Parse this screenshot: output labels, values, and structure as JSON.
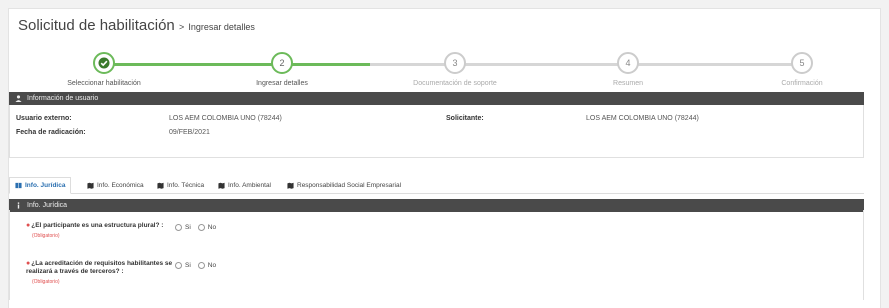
{
  "header": {
    "title": "Solicitud de habilitación",
    "breadcrumb_sep": ">",
    "breadcrumb": "Ingresar detalles"
  },
  "stepper": {
    "steps": [
      {
        "number": "✔",
        "label": "Seleccionar habilitación",
        "state": "done"
      },
      {
        "number": "2",
        "label": "Ingresar detalles",
        "state": "active"
      },
      {
        "number": "3",
        "label": "Documentación de soporte",
        "state": "pending"
      },
      {
        "number": "4",
        "label": "Resumen",
        "state": "pending"
      },
      {
        "number": "5",
        "label": "Confirmación",
        "state": "pending"
      }
    ],
    "colors": {
      "done": "#6cba5a",
      "pending": "#cccccc"
    }
  },
  "user_info": {
    "section_title": "Información de usuario",
    "section_icon": "user-icon",
    "external_user_label": "Usuario externo:",
    "external_user_value": "LOS AEM COLOMBIA UNO (78244)",
    "applicant_label": "Solicitante:",
    "applicant_value": "LOS AEM COLOMBIA UNO (78244)",
    "filing_date_label": "Fecha de radicación:",
    "filing_date_value": "09/FEB/2021"
  },
  "tabs": [
    {
      "label": "Info. Jurídica",
      "icon": "book-icon",
      "active": true
    },
    {
      "label": "Info. Económica",
      "icon": "map-icon",
      "active": false
    },
    {
      "label": "Info. Técnica",
      "icon": "map-icon",
      "active": false
    },
    {
      "label": "Info. Ambiental",
      "icon": "map-icon",
      "active": false
    },
    {
      "label": "Responsabilidad Social Empresarial",
      "icon": "map-icon",
      "active": false
    }
  ],
  "legal_section": {
    "title": "Info. Jurídica",
    "icon": "info-icon",
    "questions": [
      {
        "text": "¿El participante es una estructura plural? :",
        "required": "(Obligatorio)",
        "options": [
          "Si",
          "No"
        ]
      },
      {
        "text": "¿La acreditación de requisitos habilitantes se realizará a través de terceros? :",
        "required": "(Obligatorio)",
        "options": [
          "Si",
          "No"
        ]
      }
    ]
  },
  "colors": {
    "accent_green": "#6cba5a",
    "section_bar": "#4a4a4a",
    "required_red": "#e05050",
    "active_tab_blue": "#2a6fb0"
  }
}
